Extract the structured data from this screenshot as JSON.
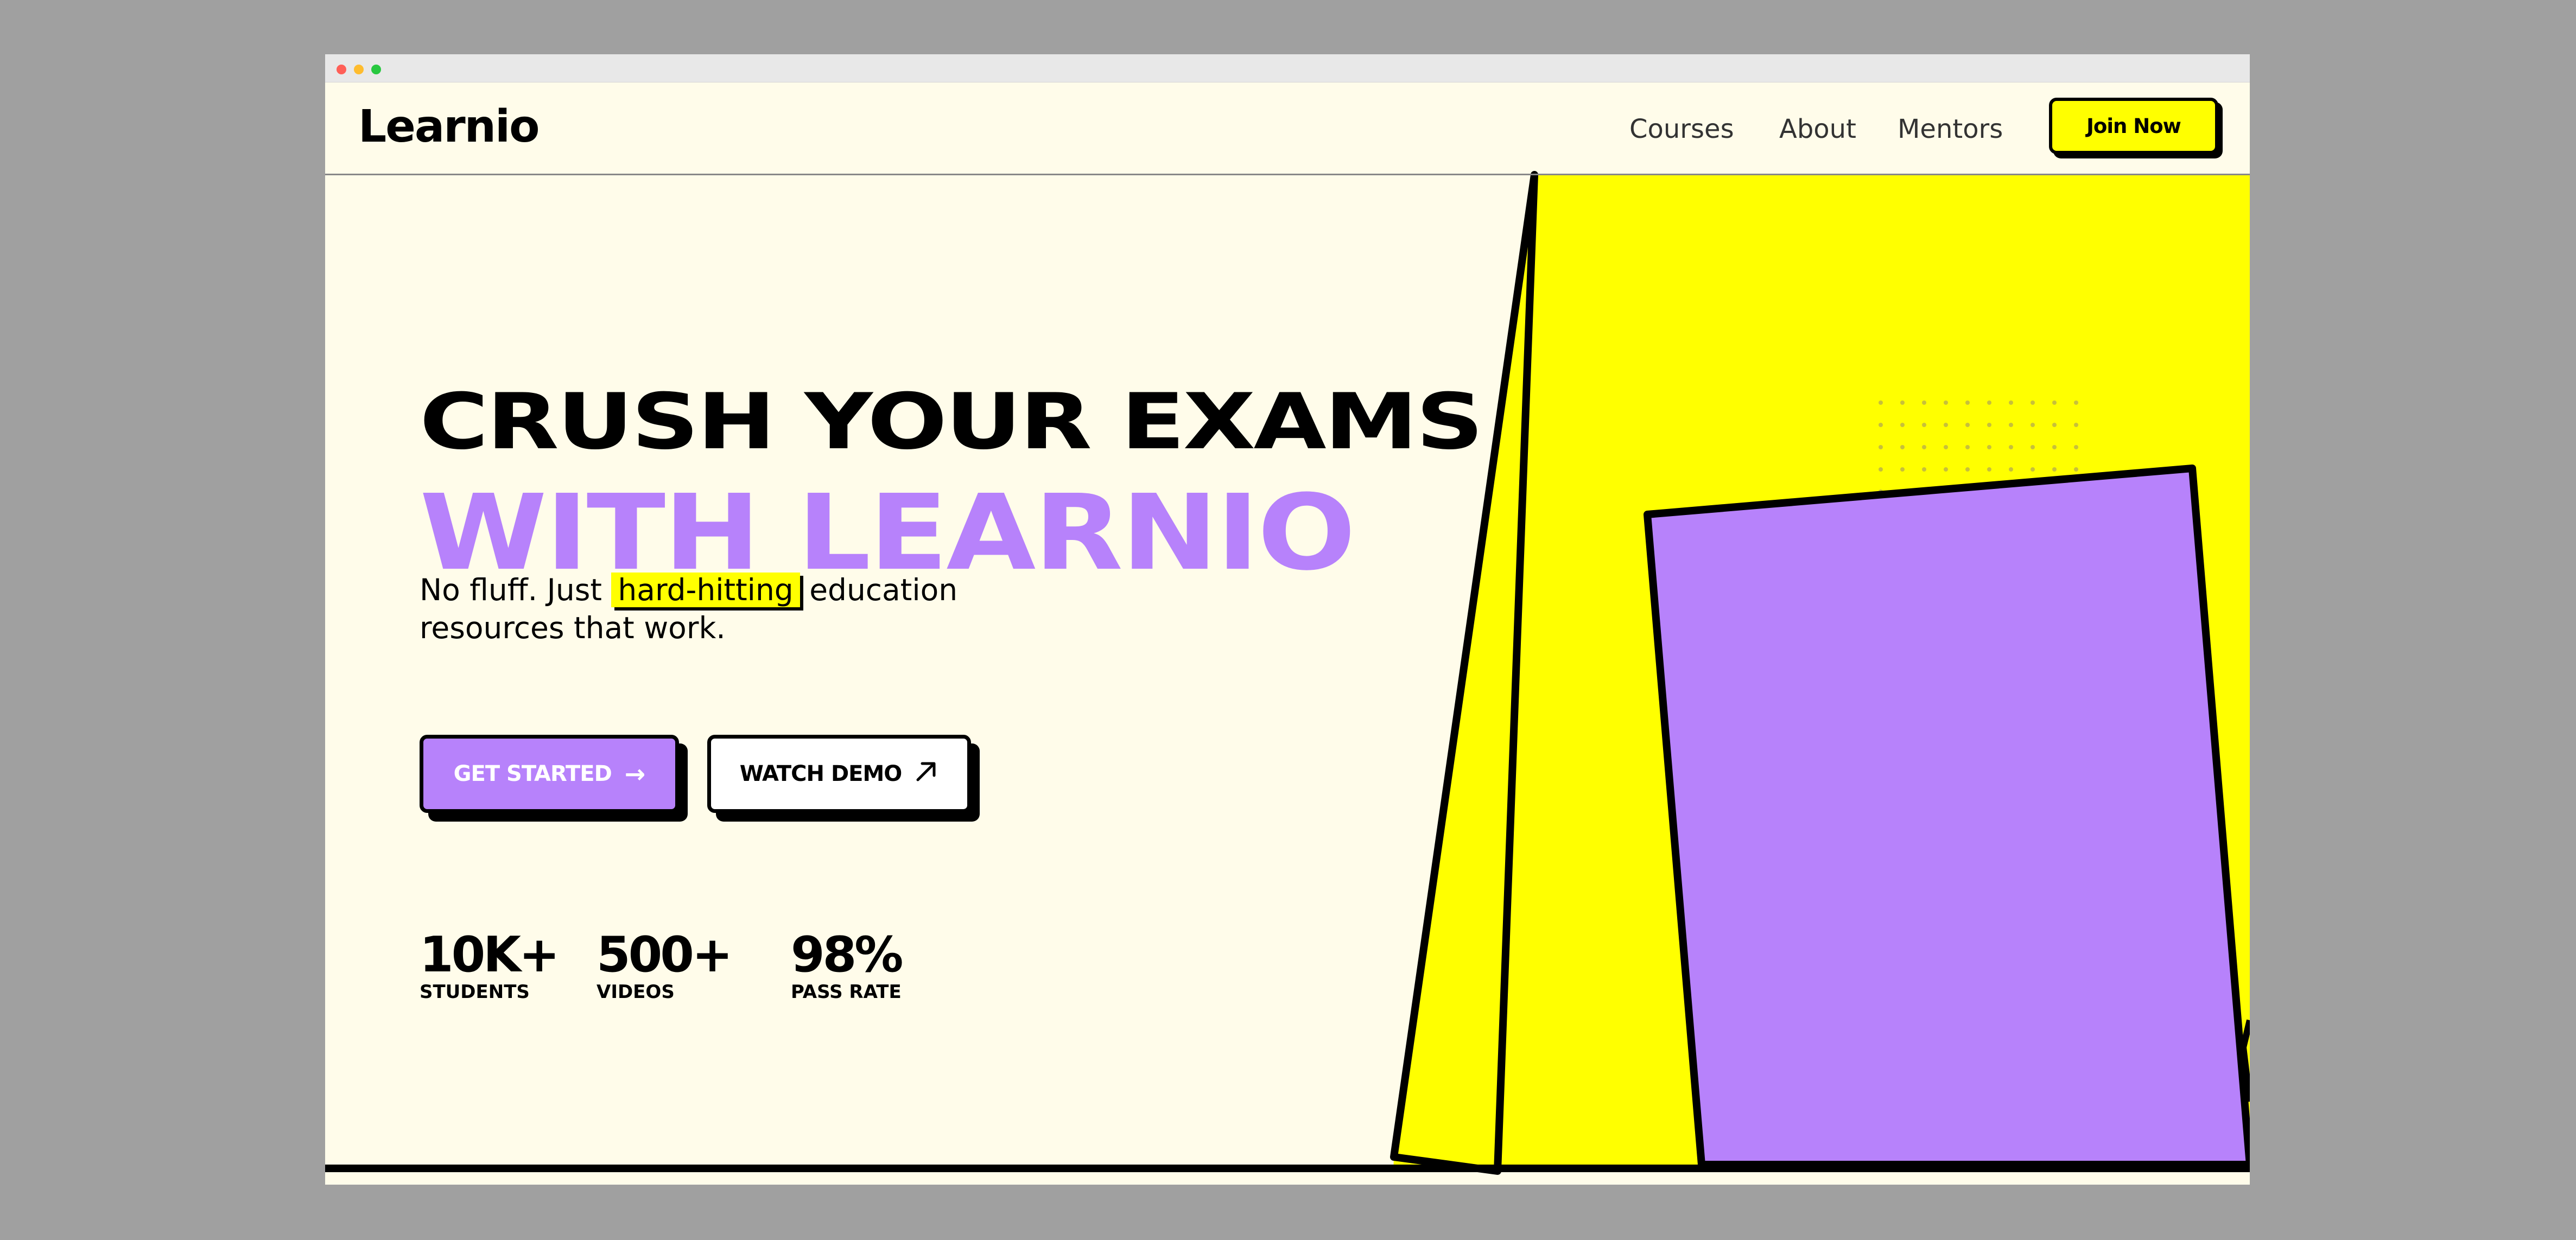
{
  "app": {
    "logo": "Learnio"
  },
  "nav": {
    "links": [
      "Courses",
      "About",
      "Mentors"
    ],
    "cta": "Join Now"
  },
  "hero": {
    "headline_line1": "CRUSH YOUR EXAMS",
    "headline_line2": "WITH LEARNIO",
    "sub_before": "No fluff. Just ",
    "sub_highlight": "hard-hitting",
    "sub_after": " education",
    "sub_line2": "resources that work.",
    "primary_button": "GET STARTED",
    "primary_icon": "arrow-right-icon",
    "secondary_button": "WATCH DEMO",
    "secondary_icon": "arrow-up-right-icon"
  },
  "stats": [
    {
      "value": "10K+",
      "label": "STUDENTS"
    },
    {
      "value": "500+",
      "label": "VIDEOS"
    },
    {
      "value": "98%",
      "label": "PASS RATE"
    }
  ],
  "colors": {
    "background": "#fffcea",
    "accent_yellow": "#ffff00",
    "accent_purple": "#b782fb",
    "ink": "#000000"
  }
}
